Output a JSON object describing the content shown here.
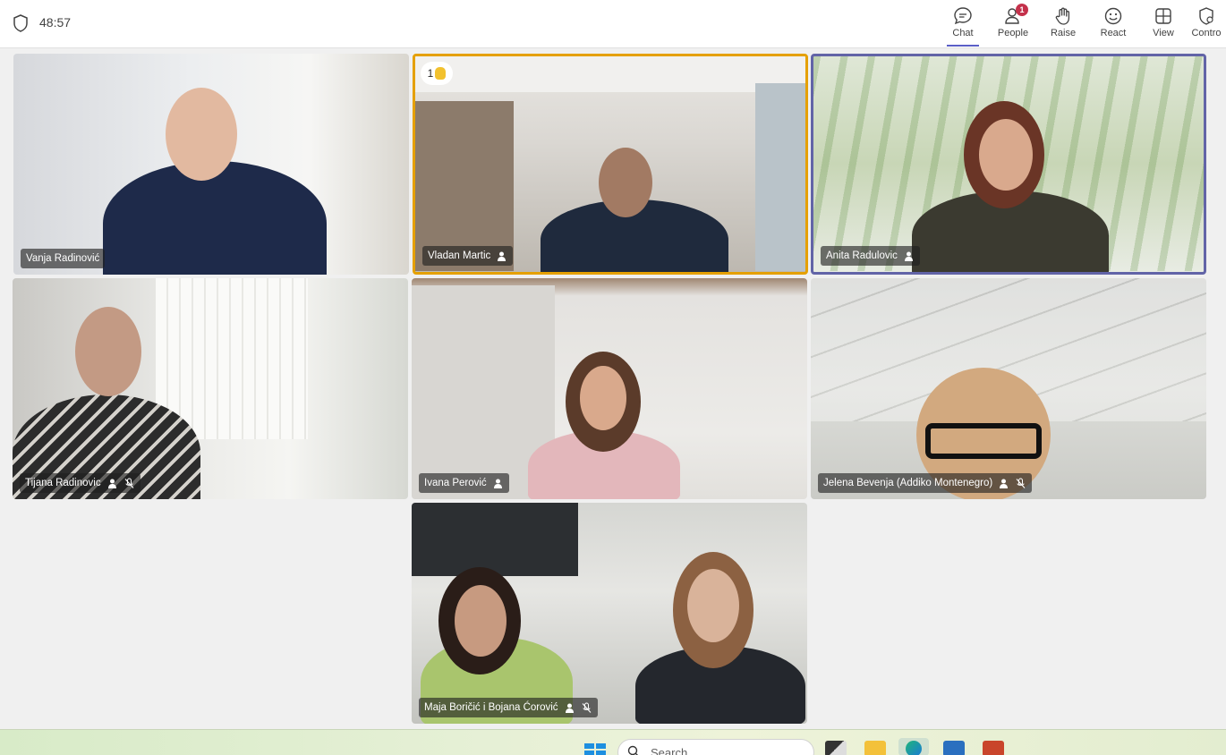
{
  "meeting": {
    "timer": "48:57"
  },
  "toolbar": {
    "chat": "Chat",
    "people": "People",
    "people_badge": "1",
    "raise": "Raise",
    "react": "React",
    "view": "View",
    "controls": "Contro"
  },
  "participants": [
    {
      "name": "Vanja Radinović",
      "muted": false
    },
    {
      "name": "Vladan Martic",
      "hand_raised_count": "1"
    },
    {
      "name": "Anita Radulovic",
      "speaking": true
    },
    {
      "name": "Tijana Radinovic",
      "muted": true
    },
    {
      "name": "Ivana Perović",
      "muted": false
    },
    {
      "name": "Jelena Bevenja (Addiko Montenegro)",
      "muted": true
    },
    {
      "name": "Maja Boričić i Bojana Ćorović",
      "muted": true
    }
  ],
  "taskbar": {
    "search_placeholder": "Search"
  },
  "colors": {
    "raised_hand_border": "#e5a000",
    "speaking_border": "#6264a7",
    "accent": "#5b5fc7"
  }
}
